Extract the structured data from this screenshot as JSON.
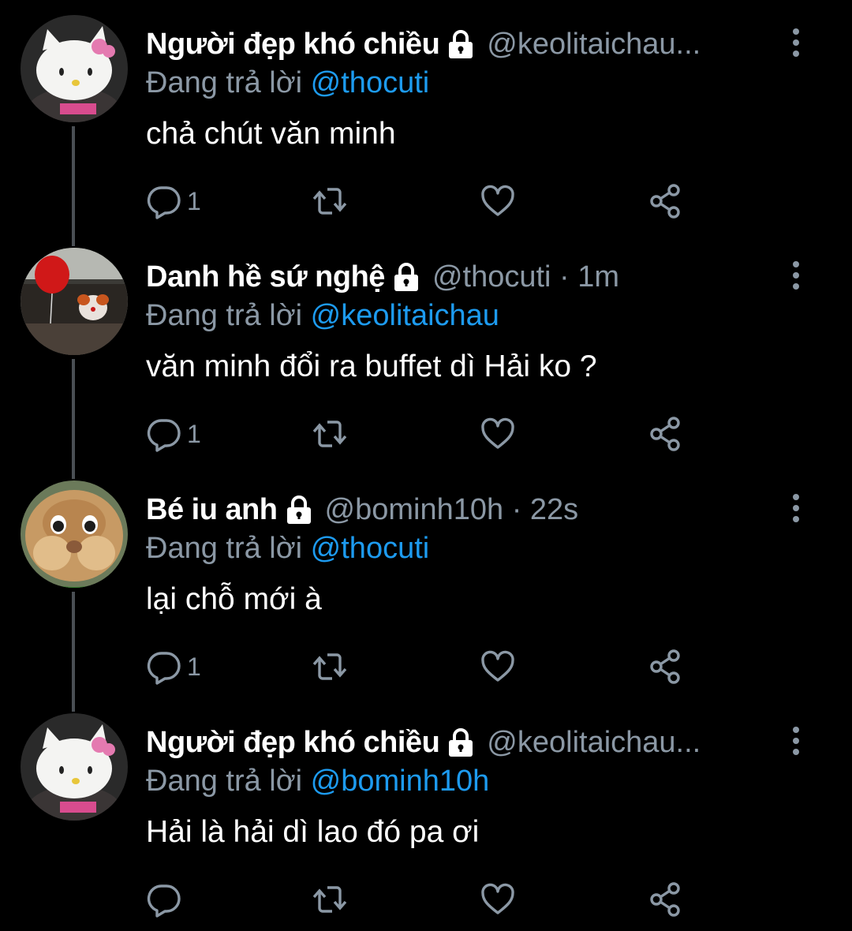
{
  "colors": {
    "background": "#000000",
    "name": "#ffffff",
    "secondary": "#8b98a5",
    "mention": "#1d9bf0",
    "thread_line": "#4a4f54"
  },
  "tweets": [
    {
      "display_name": "Người đẹp khó chiều",
      "handle": "@keolitaichau...",
      "replying_prefix": "Đang trả lời ",
      "replying_to": "@thocuti",
      "text": "chả chút văn minh",
      "reply_count": "1",
      "avatar": "hello-kitty-avatar"
    },
    {
      "display_name": "Danh hề sứ nghệ",
      "handle": "@thocuti · 1m",
      "replying_prefix": "Đang trả lời ",
      "replying_to": "@keolitaichau",
      "text": "văn minh đổi ra buffet dì Hải ko ?",
      "reply_count": "1",
      "avatar": "clown-balloon-avatar"
    },
    {
      "display_name": "Bé iu anh",
      "handle": "@bominh10h · 22s",
      "replying_prefix": "Đang trả lời ",
      "replying_to": "@thocuti",
      "text": "lại chỗ mới à",
      "reply_count": "1",
      "avatar": "chipmunk-avatar"
    },
    {
      "display_name": "Người đẹp khó chiều",
      "handle": "@keolitaichau...",
      "replying_prefix": "Đang trả lời ",
      "replying_to": "@bominh10h",
      "text": "Hải là hải dì lao đó pa ơi",
      "reply_count": "",
      "avatar": "hello-kitty-avatar"
    }
  ],
  "icons": {
    "reply": "reply-icon",
    "retweet": "retweet-icon",
    "like": "heart-icon",
    "share": "share-icon",
    "lock": "lock-icon",
    "more": "more-vertical-icon"
  }
}
